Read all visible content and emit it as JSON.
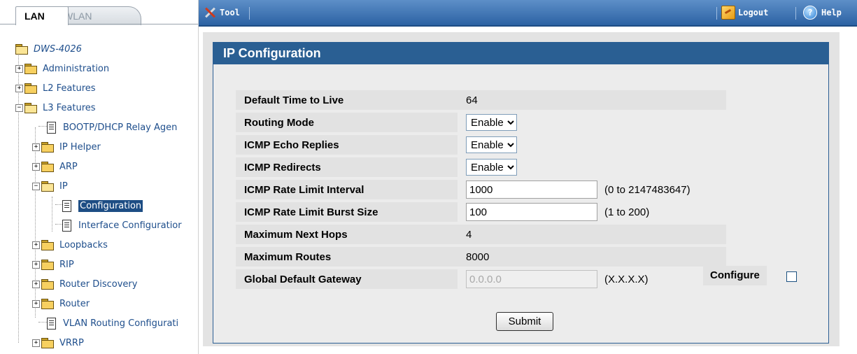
{
  "tabs": [
    {
      "label": "LAN",
      "active": true
    },
    {
      "label": "WLAN",
      "active": false
    }
  ],
  "toolbar": {
    "tool_label": "Tool",
    "logout_label": "Logout",
    "help_label": "Help",
    "bar_color": "#2c62a3"
  },
  "tree": {
    "root": "DWS-4026",
    "items": [
      {
        "label": "Administration",
        "icon": "folder-icon"
      },
      {
        "label": "L2 Features",
        "icon": "folder-icon"
      },
      {
        "label": "L3 Features",
        "icon": "folder-open-icon"
      },
      {
        "label": "BOOTP/DHCP Relay Agen",
        "icon": "document-icon"
      },
      {
        "label": "IP Helper",
        "icon": "folder-icon"
      },
      {
        "label": "ARP",
        "icon": "folder-icon"
      },
      {
        "label": "IP",
        "icon": "folder-open-icon"
      },
      {
        "label": "Configuration",
        "icon": "document-icon",
        "selected": true
      },
      {
        "label": "Interface Configuratior",
        "icon": "document-icon"
      },
      {
        "label": "Loopbacks",
        "icon": "folder-icon"
      },
      {
        "label": "RIP",
        "icon": "folder-icon"
      },
      {
        "label": "Router Discovery",
        "icon": "folder-icon"
      },
      {
        "label": "Router",
        "icon": "folder-icon"
      },
      {
        "label": "VLAN Routing Configurati",
        "icon": "document-icon"
      },
      {
        "label": "VRRP",
        "icon": "folder-icon"
      }
    ]
  },
  "panel": {
    "title": "IP Configuration",
    "title_color": "#2a5f93",
    "fields": {
      "ttl": {
        "label": "Default Time to Live",
        "value": "64"
      },
      "routing_mode": {
        "label": "Routing Mode",
        "value": "Enable"
      },
      "icmp_echo": {
        "label": "ICMP Echo Replies",
        "value": "Enable"
      },
      "icmp_redirects": {
        "label": "ICMP Redirects",
        "value": "Enable"
      },
      "icmp_interval": {
        "label": "ICMP Rate Limit Interval",
        "value": "1000",
        "hint": "(0 to 2147483647)"
      },
      "icmp_burst": {
        "label": "ICMP Rate Limit Burst Size",
        "value": "100",
        "hint": "(1 to 200)"
      },
      "max_hops": {
        "label": "Maximum Next Hops",
        "value": "4"
      },
      "max_routes": {
        "label": "Maximum Routes",
        "value": "8000"
      },
      "gateway": {
        "label": "Global Default Gateway",
        "value": "0.0.0.0",
        "hint": "(X.X.X.X)",
        "configure_label": "Configure"
      }
    },
    "submit_label": "Submit"
  }
}
